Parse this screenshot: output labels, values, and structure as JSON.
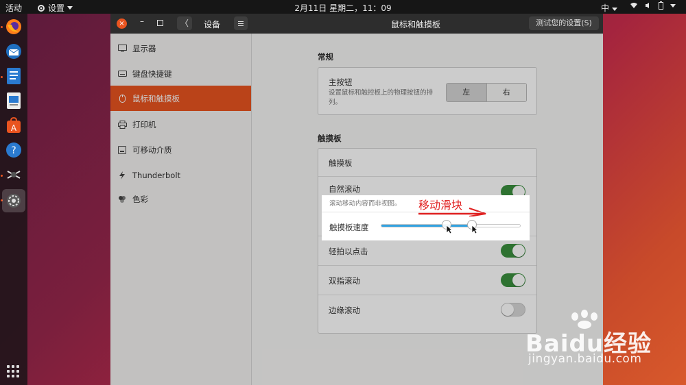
{
  "topbar": {
    "activities": "活动",
    "app_menu": "设置",
    "clock": "2月11日 星期二，11：09",
    "input_method": "中"
  },
  "window": {
    "back_title": "设备",
    "title": "鼠标和触摸板",
    "test_button": "测试您的设置(S)"
  },
  "sidebar": {
    "items": [
      {
        "label": "显示器",
        "icon": "display-icon"
      },
      {
        "label": "键盘快捷键",
        "icon": "keyboard-icon"
      },
      {
        "label": "鼠标和触摸板",
        "icon": "mouse-icon",
        "selected": true
      },
      {
        "label": "打印机",
        "icon": "printer-icon"
      },
      {
        "label": "可移动介质",
        "icon": "removable-media-icon"
      },
      {
        "label": "Thunderbolt",
        "icon": "thunderbolt-icon"
      },
      {
        "label": "色彩",
        "icon": "color-icon"
      }
    ]
  },
  "general": {
    "section_title": "常规",
    "primary_button_label": "主按钮",
    "primary_button_desc": "设置鼠标和触控板上的物理按钮的排列。",
    "left": "左",
    "right": "右",
    "selected": "左"
  },
  "touchpad": {
    "section_title": "触摸板",
    "touchpad_row": "触摸板",
    "natural_scroll": "自然滚动",
    "natural_scroll_desc": "滚动移动内容而非视图。",
    "natural_scroll_on": true,
    "speed_label": "触摸板速度",
    "speed_value": 0.65,
    "tap_to_click": "轻拍以点击",
    "tap_to_click_on": true,
    "two_finger_scroll": "双指滚动",
    "two_finger_scroll_on": true,
    "edge_scroll": "边缘滚动",
    "edge_scroll_on": false
  },
  "annotation": {
    "text": "移动滑块"
  },
  "watermark": {
    "logo": "Baidu经验",
    "url": "jingyan.baidu.com"
  },
  "colors": {
    "accent": "#e95420",
    "switch_on": "#3a8f3e",
    "slider_fill": "#33a2e0",
    "annotation": "#e02020"
  }
}
